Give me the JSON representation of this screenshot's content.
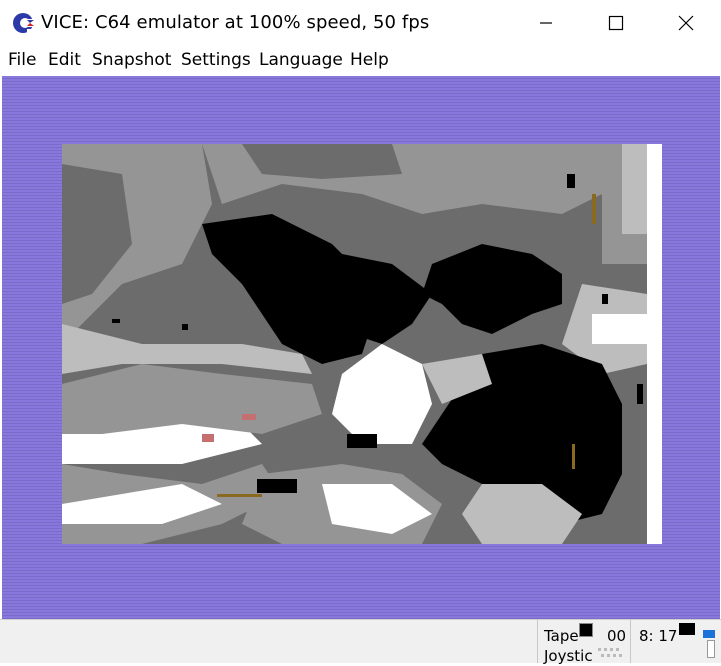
{
  "window": {
    "title": "VICE: C64 emulator at 100% speed, 50 fps"
  },
  "menu": {
    "file": "File",
    "edit": "Edit",
    "snapshot": "Snapshot",
    "settings": "Settings",
    "language": "Language",
    "help": "Help"
  },
  "colors": {
    "border": "#8877dc",
    "screen_black": "#000000",
    "screen_white": "#ffffff"
  },
  "status": {
    "tape_label": "Tape",
    "tape_counter": "00",
    "drive_label": "8: 17",
    "joystick_label": "Joystic"
  },
  "icons": [
    "c64-logo-icon",
    "minimize-icon",
    "maximize-icon",
    "close-icon"
  ]
}
